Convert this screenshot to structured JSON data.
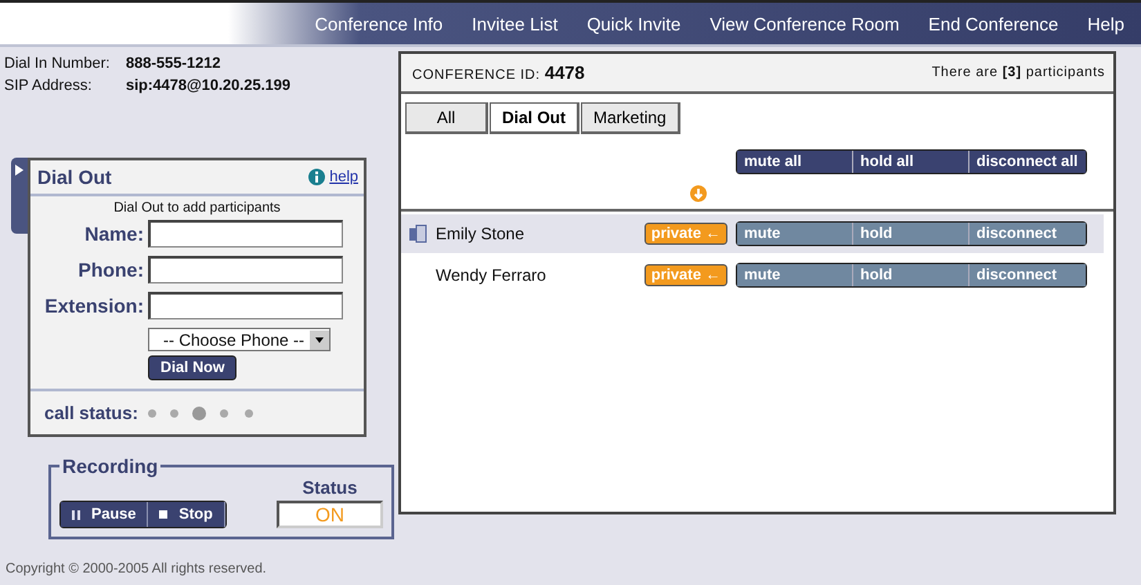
{
  "nav": [
    "Conference Info",
    "Invitee List",
    "Quick Invite",
    "View Conference Room",
    "End Conference",
    "Help"
  ],
  "dial_in": {
    "label": "Dial In Number:",
    "value": "888-555-1212"
  },
  "sip": {
    "label": "SIP Address:",
    "value": "sip:4478@10.20.25.199"
  },
  "dial_out": {
    "title": "Dial Out",
    "help": "help",
    "hint": "Dial Out to add participants",
    "fields": [
      {
        "label": "Name:"
      },
      {
        "label": "Phone:"
      },
      {
        "label": "Extension:"
      }
    ],
    "phone_select": "-- Choose Phone --",
    "dial_button": "Dial Now",
    "call_status": "call status:"
  },
  "recording": {
    "title": "Recording",
    "pause": "Pause",
    "stop": "Stop",
    "status_label": "Status",
    "status": "ON"
  },
  "copyright": "Copyright © 2000-2005 All rights reserved.",
  "conference": {
    "id_label": "CONFERENCE ID:",
    "id": "4478",
    "participants": "There are **[3]** participants",
    "tabs": [
      {
        "label": "All",
        "selected": false
      },
      {
        "label": "Dial Out",
        "selected": true
      },
      {
        "label": "Marketing",
        "selected": false
      }
    ],
    "all_buttons": [
      "mute all",
      "hold all",
      "disconnect all"
    ],
    "rows": [
      {
        "name": "Emily Stone",
        "selected": true,
        "private": "private ←",
        "buttons": [
          "mute",
          "hold",
          "disconnect"
        ]
      },
      {
        "name": "Wendy Ferraro",
        "selected": false,
        "private": "private ←",
        "buttons": [
          "mute",
          "hold",
          "disconnect"
        ]
      }
    ]
  }
}
